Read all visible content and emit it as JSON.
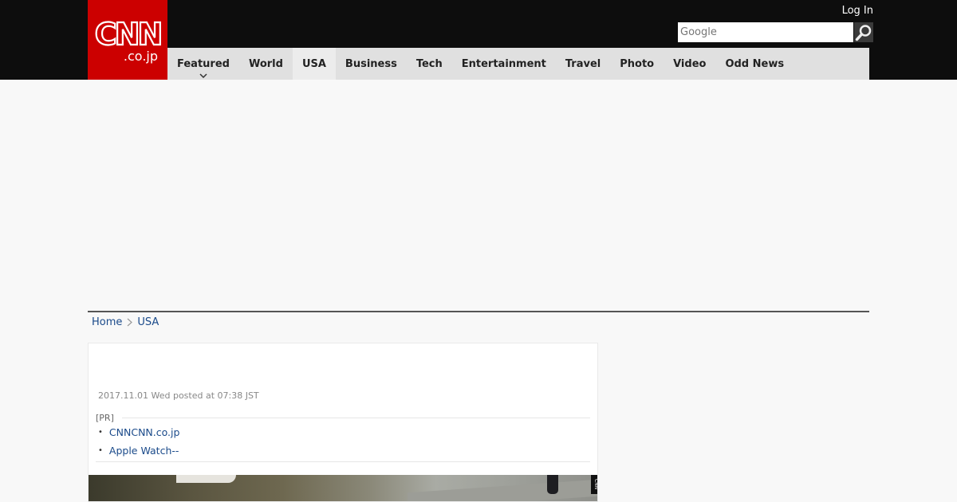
{
  "header": {
    "logo_main": "CNN",
    "logo_sub": ".co.jp",
    "login_label": "Log In",
    "search_placeholder": "Google"
  },
  "nav": {
    "items": [
      {
        "label": "Featured"
      },
      {
        "label": "World"
      },
      {
        "label": "USA"
      },
      {
        "label": "Business"
      },
      {
        "label": "Tech"
      },
      {
        "label": "Entertainment"
      },
      {
        "label": "Travel"
      },
      {
        "label": "Photo"
      },
      {
        "label": "Video"
      },
      {
        "label": "Odd News"
      }
    ],
    "active": "USA"
  },
  "breadcrumb": {
    "home": "Home",
    "section": "USA"
  },
  "article": {
    "dateline": "2017.11.01 Wed posted at 07:38 JST",
    "pr_label": "[PR]",
    "pr_links": [
      "CNNCNN.co.jp",
      "Apple Watch--"
    ],
    "photo_tag": "CNN"
  },
  "colors": {
    "brand_red": "#cc0000",
    "header_bg": "#0d0d0d",
    "nav_bg": "#e0e0e0",
    "link": "#1a4a8a"
  },
  "icons": {
    "search": "magnifier-icon",
    "dropdown": "chevron-down-icon",
    "breadcrumb_separator": "chevron-right-icon"
  }
}
